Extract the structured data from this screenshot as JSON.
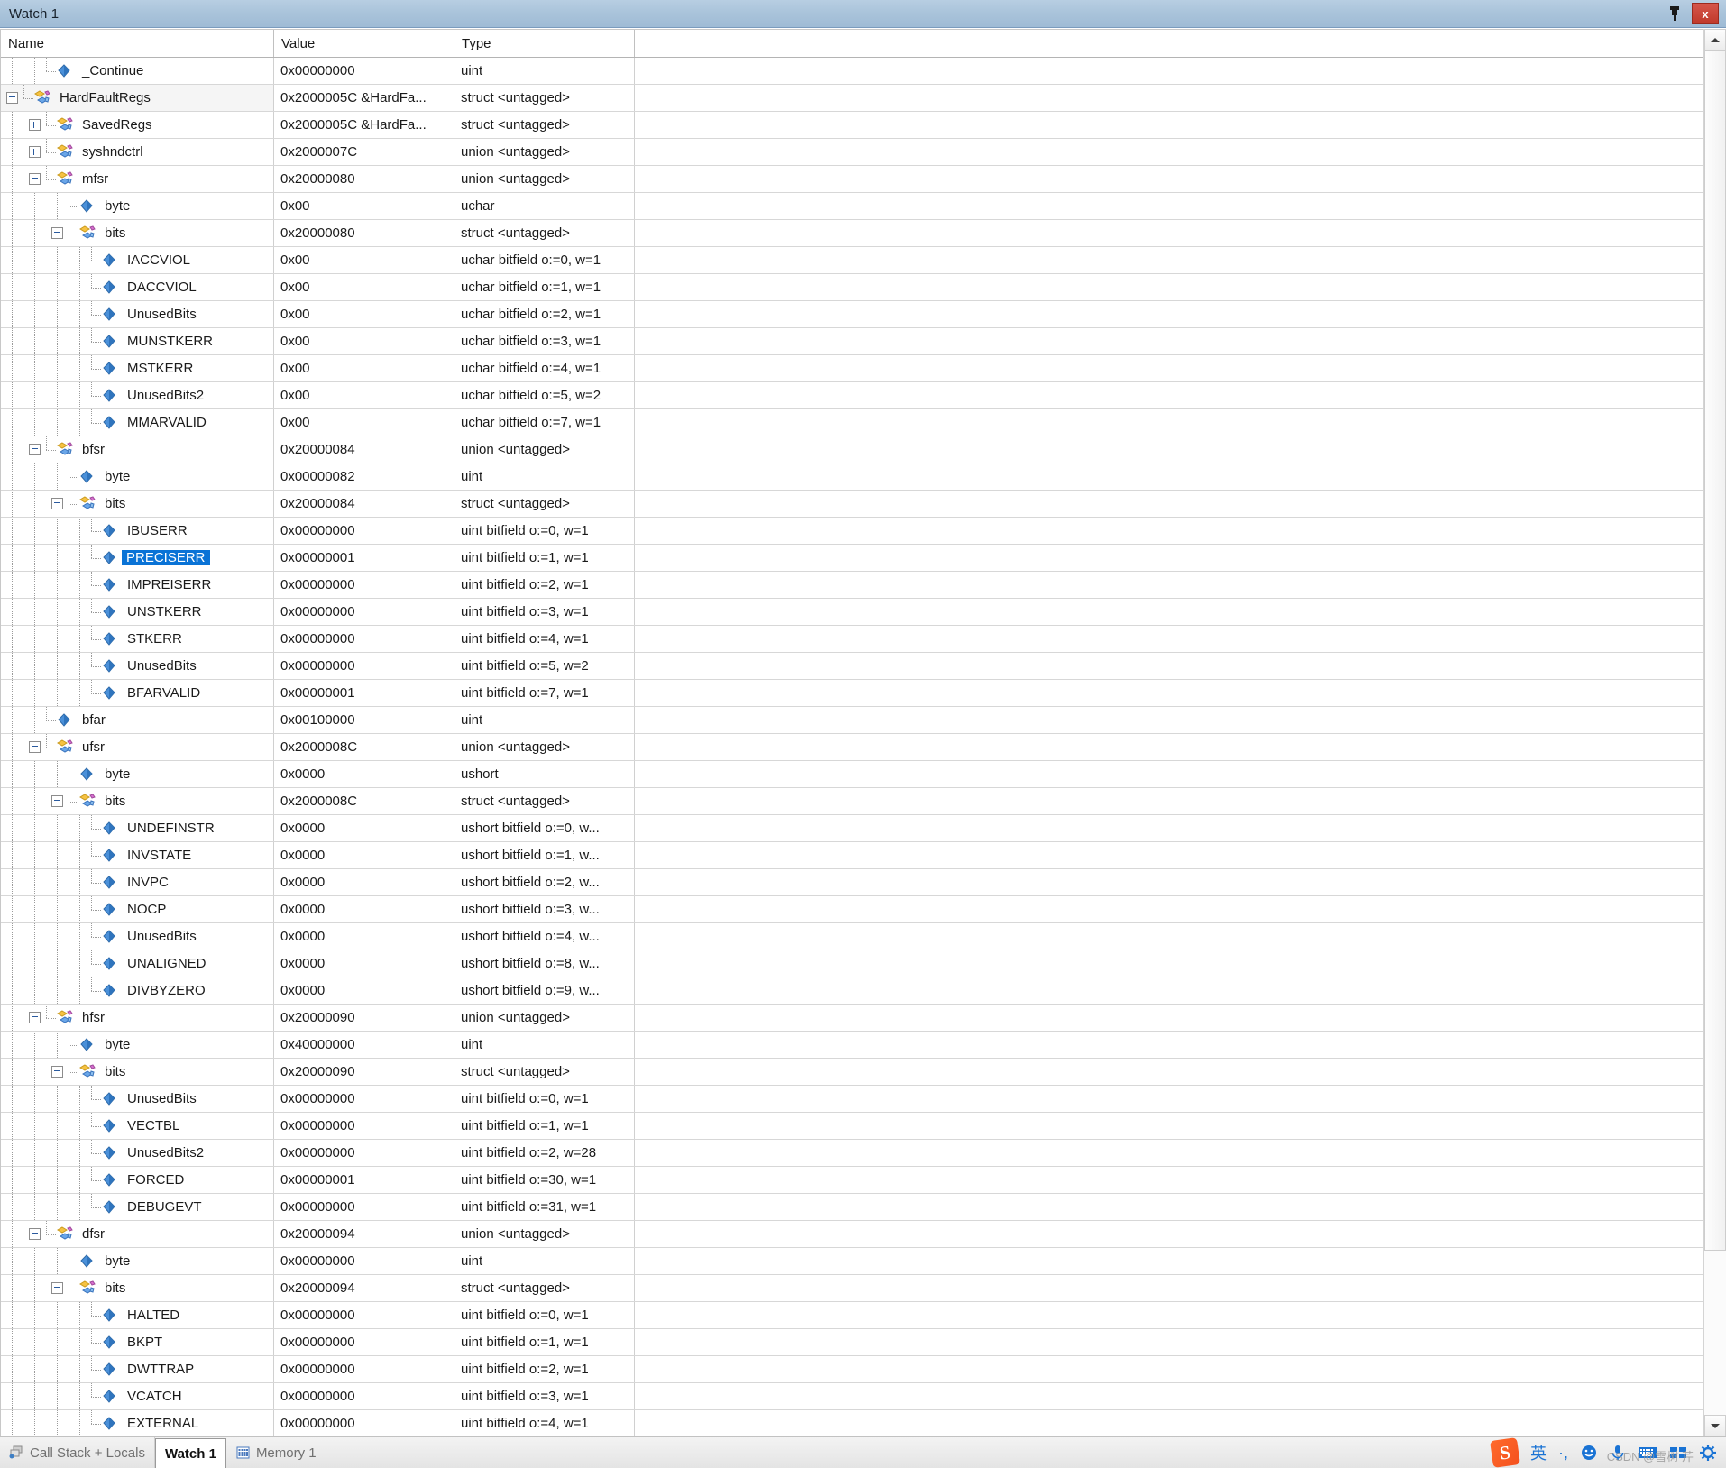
{
  "window": {
    "title": "Watch 1",
    "pin_icon": "pin-icon",
    "close_label": "x"
  },
  "grid": {
    "columns": [
      "Name",
      "Value",
      "Type"
    ],
    "selected_row": "PRECISERR",
    "rows": [
      {
        "name": "_Continue",
        "value": "0x00000000",
        "type": "uint",
        "depth": 1,
        "icon": "blue-diamond",
        "exp": "none"
      },
      {
        "name": "HardFaultRegs",
        "value": "0x2000005C &HardFa...",
        "type": "struct <untagged>",
        "depth": 0,
        "icon": "gold-node",
        "exp": "minus",
        "shade": true
      },
      {
        "name": "SavedRegs",
        "value": "0x2000005C &HardFa...",
        "type": "struct <untagged>",
        "depth": 1,
        "icon": "gold-node",
        "exp": "plus"
      },
      {
        "name": "syshndctrl",
        "value": "0x2000007C",
        "type": "union <untagged>",
        "depth": 1,
        "icon": "gold-node",
        "exp": "plus"
      },
      {
        "name": "mfsr",
        "value": "0x20000080",
        "type": "union <untagged>",
        "depth": 1,
        "icon": "gold-node",
        "exp": "minus"
      },
      {
        "name": "byte",
        "value": "0x00",
        "type": "uchar",
        "depth": 2,
        "icon": "blue-diamond",
        "exp": "none"
      },
      {
        "name": "bits",
        "value": "0x20000080",
        "type": "struct <untagged>",
        "depth": 2,
        "icon": "gold-node",
        "exp": "minus"
      },
      {
        "name": "IACCVIOL",
        "value": "0x00",
        "type": "uchar bitfield o:=0, w=1",
        "depth": 3,
        "icon": "blue-diamond",
        "exp": "none"
      },
      {
        "name": "DACCVIOL",
        "value": "0x00",
        "type": "uchar bitfield o:=1, w=1",
        "depth": 3,
        "icon": "blue-diamond",
        "exp": "none"
      },
      {
        "name": "UnusedBits",
        "value": "0x00",
        "type": "uchar bitfield o:=2, w=1",
        "depth": 3,
        "icon": "blue-diamond",
        "exp": "none"
      },
      {
        "name": "MUNSTKERR",
        "value": "0x00",
        "type": "uchar bitfield o:=3, w=1",
        "depth": 3,
        "icon": "blue-diamond",
        "exp": "none"
      },
      {
        "name": "MSTKERR",
        "value": "0x00",
        "type": "uchar bitfield o:=4, w=1",
        "depth": 3,
        "icon": "blue-diamond",
        "exp": "none"
      },
      {
        "name": "UnusedBits2",
        "value": "0x00",
        "type": "uchar bitfield o:=5, w=2",
        "depth": 3,
        "icon": "blue-diamond",
        "exp": "none"
      },
      {
        "name": "MMARVALID",
        "value": "0x00",
        "type": "uchar bitfield o:=7, w=1",
        "depth": 3,
        "icon": "blue-diamond",
        "exp": "none"
      },
      {
        "name": "bfsr",
        "value": "0x20000084",
        "type": "union <untagged>",
        "depth": 1,
        "icon": "gold-node",
        "exp": "minus"
      },
      {
        "name": "byte",
        "value": "0x00000082",
        "type": "uint",
        "depth": 2,
        "icon": "blue-diamond",
        "exp": "none"
      },
      {
        "name": "bits",
        "value": "0x20000084",
        "type": "struct <untagged>",
        "depth": 2,
        "icon": "gold-node",
        "exp": "minus"
      },
      {
        "name": "IBUSERR",
        "value": "0x00000000",
        "type": "uint bitfield o:=0, w=1",
        "depth": 3,
        "icon": "blue-diamond",
        "exp": "none"
      },
      {
        "name": "PRECISERR",
        "value": "0x00000001",
        "type": "uint bitfield o:=1, w=1",
        "depth": 3,
        "icon": "blue-diamond",
        "exp": "none",
        "selected": true
      },
      {
        "name": "IMPREISERR",
        "value": "0x00000000",
        "type": "uint bitfield o:=2, w=1",
        "depth": 3,
        "icon": "blue-diamond",
        "exp": "none"
      },
      {
        "name": "UNSTKERR",
        "value": "0x00000000",
        "type": "uint bitfield o:=3, w=1",
        "depth": 3,
        "icon": "blue-diamond",
        "exp": "none"
      },
      {
        "name": "STKERR",
        "value": "0x00000000",
        "type": "uint bitfield o:=4, w=1",
        "depth": 3,
        "icon": "blue-diamond",
        "exp": "none"
      },
      {
        "name": "UnusedBits",
        "value": "0x00000000",
        "type": "uint bitfield o:=5, w=2",
        "depth": 3,
        "icon": "blue-diamond",
        "exp": "none"
      },
      {
        "name": "BFARVALID",
        "value": "0x00000001",
        "type": "uint bitfield o:=7, w=1",
        "depth": 3,
        "icon": "blue-diamond",
        "exp": "none"
      },
      {
        "name": "bfar",
        "value": "0x00100000",
        "type": "uint",
        "depth": 1,
        "icon": "blue-diamond",
        "exp": "none"
      },
      {
        "name": "ufsr",
        "value": "0x2000008C",
        "type": "union <untagged>",
        "depth": 1,
        "icon": "gold-node",
        "exp": "minus"
      },
      {
        "name": "byte",
        "value": "0x0000",
        "type": "ushort",
        "depth": 2,
        "icon": "blue-diamond",
        "exp": "none"
      },
      {
        "name": "bits",
        "value": "0x2000008C",
        "type": "struct <untagged>",
        "depth": 2,
        "icon": "gold-node",
        "exp": "minus"
      },
      {
        "name": "UNDEFINSTR",
        "value": "0x0000",
        "type": "ushort bitfield o:=0, w...",
        "depth": 3,
        "icon": "blue-diamond",
        "exp": "none"
      },
      {
        "name": "INVSTATE",
        "value": "0x0000",
        "type": "ushort bitfield o:=1, w...",
        "depth": 3,
        "icon": "blue-diamond",
        "exp": "none"
      },
      {
        "name": "INVPC",
        "value": "0x0000",
        "type": "ushort bitfield o:=2, w...",
        "depth": 3,
        "icon": "blue-diamond",
        "exp": "none"
      },
      {
        "name": "NOCP",
        "value": "0x0000",
        "type": "ushort bitfield o:=3, w...",
        "depth": 3,
        "icon": "blue-diamond",
        "exp": "none"
      },
      {
        "name": "UnusedBits",
        "value": "0x0000",
        "type": "ushort bitfield o:=4, w...",
        "depth": 3,
        "icon": "blue-diamond",
        "exp": "none"
      },
      {
        "name": "UNALIGNED",
        "value": "0x0000",
        "type": "ushort bitfield o:=8, w...",
        "depth": 3,
        "icon": "blue-diamond",
        "exp": "none"
      },
      {
        "name": "DIVBYZERO",
        "value": "0x0000",
        "type": "ushort bitfield o:=9, w...",
        "depth": 3,
        "icon": "blue-diamond",
        "exp": "none"
      },
      {
        "name": "hfsr",
        "value": "0x20000090",
        "type": "union <untagged>",
        "depth": 1,
        "icon": "gold-node",
        "exp": "minus"
      },
      {
        "name": "byte",
        "value": "0x40000000",
        "type": "uint",
        "depth": 2,
        "icon": "blue-diamond",
        "exp": "none"
      },
      {
        "name": "bits",
        "value": "0x20000090",
        "type": "struct <untagged>",
        "depth": 2,
        "icon": "gold-node",
        "exp": "minus"
      },
      {
        "name": "UnusedBits",
        "value": "0x00000000",
        "type": "uint bitfield o:=0, w=1",
        "depth": 3,
        "icon": "blue-diamond",
        "exp": "none"
      },
      {
        "name": "VECTBL",
        "value": "0x00000000",
        "type": "uint bitfield o:=1, w=1",
        "depth": 3,
        "icon": "blue-diamond",
        "exp": "none"
      },
      {
        "name": "UnusedBits2",
        "value": "0x00000000",
        "type": "uint bitfield o:=2, w=28",
        "depth": 3,
        "icon": "blue-diamond",
        "exp": "none"
      },
      {
        "name": "FORCED",
        "value": "0x00000001",
        "type": "uint bitfield o:=30, w=1",
        "depth": 3,
        "icon": "blue-diamond",
        "exp": "none"
      },
      {
        "name": "DEBUGEVT",
        "value": "0x00000000",
        "type": "uint bitfield o:=31, w=1",
        "depth": 3,
        "icon": "blue-diamond",
        "exp": "none"
      },
      {
        "name": "dfsr",
        "value": "0x20000094",
        "type": "union <untagged>",
        "depth": 1,
        "icon": "gold-node",
        "exp": "minus"
      },
      {
        "name": "byte",
        "value": "0x00000000",
        "type": "uint",
        "depth": 2,
        "icon": "blue-diamond",
        "exp": "none"
      },
      {
        "name": "bits",
        "value": "0x20000094",
        "type": "struct <untagged>",
        "depth": 2,
        "icon": "gold-node",
        "exp": "minus"
      },
      {
        "name": "HALTED",
        "value": "0x00000000",
        "type": "uint bitfield o:=0, w=1",
        "depth": 3,
        "icon": "blue-diamond",
        "exp": "none"
      },
      {
        "name": "BKPT",
        "value": "0x00000000",
        "type": "uint bitfield o:=1, w=1",
        "depth": 3,
        "icon": "blue-diamond",
        "exp": "none"
      },
      {
        "name": "DWTTRAP",
        "value": "0x00000000",
        "type": "uint bitfield o:=2, w=1",
        "depth": 3,
        "icon": "blue-diamond",
        "exp": "none"
      },
      {
        "name": "VCATCH",
        "value": "0x00000000",
        "type": "uint bitfield o:=3, w=1",
        "depth": 3,
        "icon": "blue-diamond",
        "exp": "none"
      },
      {
        "name": "EXTERNAL",
        "value": "0x00000000",
        "type": "uint bitfield o:=4, w=1",
        "depth": 3,
        "icon": "blue-diamond",
        "exp": "none"
      }
    ]
  },
  "tabs": [
    {
      "label": "Call Stack + Locals",
      "icon": "call-stack-icon",
      "active": false
    },
    {
      "label": "Watch 1",
      "icon": "",
      "active": true
    },
    {
      "label": "Memory 1",
      "icon": "memory-icon",
      "active": false
    }
  ],
  "ime": {
    "logo": "S",
    "items": [
      "英",
      "·,",
      "☺",
      "🎤",
      "⌨",
      "▯▯",
      "☼"
    ]
  },
  "watermark": "CSDN @雪树 芹",
  "colors": {
    "selection": "#0a73d6",
    "title_bar": "#a9c3da",
    "close_button": "#c0392b",
    "ime_blue": "#1a73d4",
    "ime_orange": "#f4511e"
  }
}
